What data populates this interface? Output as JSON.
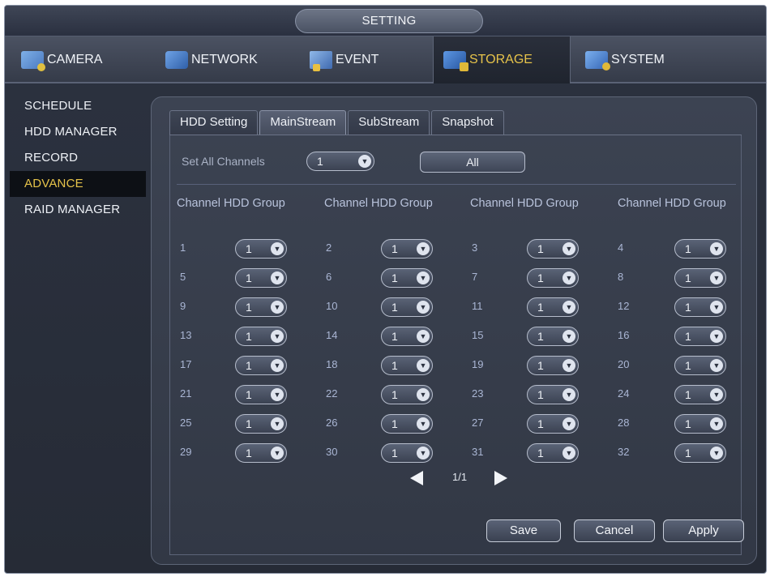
{
  "window": {
    "title": "SETTING"
  },
  "topnav": {
    "items": [
      {
        "label": "CAMERA",
        "icon": "camera-icon",
        "active": false
      },
      {
        "label": "NETWORK",
        "icon": "network-icon",
        "active": false
      },
      {
        "label": "EVENT",
        "icon": "event-icon",
        "active": false
      },
      {
        "label": "STORAGE",
        "icon": "storage-icon",
        "active": true
      },
      {
        "label": "SYSTEM",
        "icon": "system-icon",
        "active": false
      }
    ]
  },
  "sidebar": {
    "items": [
      {
        "label": "SCHEDULE",
        "active": false
      },
      {
        "label": "HDD MANAGER",
        "active": false
      },
      {
        "label": "RECORD",
        "active": false
      },
      {
        "label": "ADVANCE",
        "active": true
      },
      {
        "label": "RAID MANAGER",
        "active": false
      }
    ]
  },
  "tabs": [
    {
      "label": "HDD Setting",
      "active": false
    },
    {
      "label": "MainStream",
      "active": true
    },
    {
      "label": "SubStream",
      "active": false
    },
    {
      "label": "Snapshot",
      "active": false
    }
  ],
  "set_all": {
    "label": "Set All Channels",
    "value": "1",
    "all_button": "All"
  },
  "table": {
    "column_header": "Channel HDD Group",
    "channels": [
      {
        "channel": "1",
        "group": "1"
      },
      {
        "channel": "2",
        "group": "1"
      },
      {
        "channel": "3",
        "group": "1"
      },
      {
        "channel": "4",
        "group": "1"
      },
      {
        "channel": "5",
        "group": "1"
      },
      {
        "channel": "6",
        "group": "1"
      },
      {
        "channel": "7",
        "group": "1"
      },
      {
        "channel": "8",
        "group": "1"
      },
      {
        "channel": "9",
        "group": "1"
      },
      {
        "channel": "10",
        "group": "1"
      },
      {
        "channel": "11",
        "group": "1"
      },
      {
        "channel": "12",
        "group": "1"
      },
      {
        "channel": "13",
        "group": "1"
      },
      {
        "channel": "14",
        "group": "1"
      },
      {
        "channel": "15",
        "group": "1"
      },
      {
        "channel": "16",
        "group": "1"
      },
      {
        "channel": "17",
        "group": "1"
      },
      {
        "channel": "18",
        "group": "1"
      },
      {
        "channel": "19",
        "group": "1"
      },
      {
        "channel": "20",
        "group": "1"
      },
      {
        "channel": "21",
        "group": "1"
      },
      {
        "channel": "22",
        "group": "1"
      },
      {
        "channel": "23",
        "group": "1"
      },
      {
        "channel": "24",
        "group": "1"
      },
      {
        "channel": "25",
        "group": "1"
      },
      {
        "channel": "26",
        "group": "1"
      },
      {
        "channel": "27",
        "group": "1"
      },
      {
        "channel": "28",
        "group": "1"
      },
      {
        "channel": "29",
        "group": "1"
      },
      {
        "channel": "30",
        "group": "1"
      },
      {
        "channel": "31",
        "group": "1"
      },
      {
        "channel": "32",
        "group": "1"
      }
    ]
  },
  "pager": {
    "text": "1/1"
  },
  "buttons": {
    "save": "Save",
    "cancel": "Cancel",
    "apply": "Apply"
  },
  "colors": {
    "accent": "#e6c34a",
    "background": "#2c3240"
  }
}
